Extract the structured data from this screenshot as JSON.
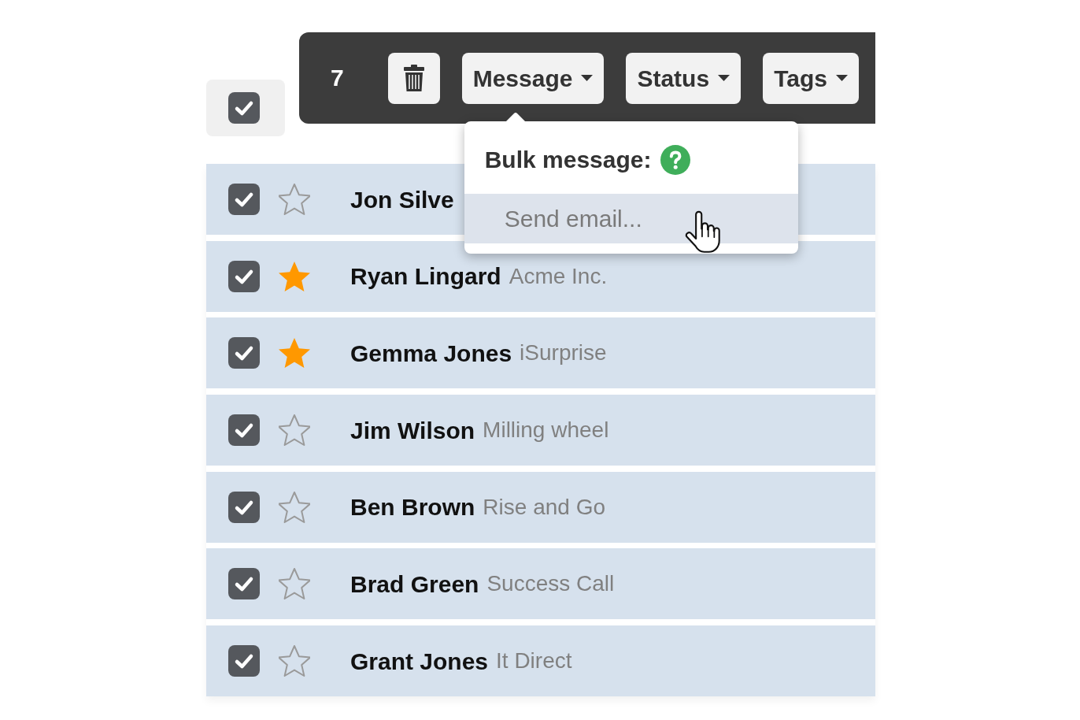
{
  "select_all": {
    "checked": true
  },
  "bulk_toolbar": {
    "count": "7",
    "buttons": [
      {
        "kind": "delete"
      },
      {
        "kind": "dropdown",
        "label": "Message",
        "expanded": true
      },
      {
        "kind": "dropdown",
        "label": "Status",
        "expanded": false
      },
      {
        "kind": "dropdown",
        "label": "Tags",
        "expanded": false
      }
    ]
  },
  "message_menu": {
    "title": "Bulk message:",
    "items": [
      {
        "label": "Send email...",
        "hovered": true
      }
    ]
  },
  "rows": [
    {
      "name": "Jon Silve",
      "checked": true,
      "starred": false
    },
    {
      "name": "Ryan Lingard",
      "company": "Acme Inc.",
      "checked": true,
      "starred": true
    },
    {
      "name": "Gemma Jones",
      "company": "iSurprise",
      "checked": true,
      "starred": true
    },
    {
      "name": "Jim Wilson",
      "company": "Milling wheel",
      "checked": true,
      "starred": false
    },
    {
      "name": "Ben Brown",
      "company": "Rise and Go",
      "checked": true,
      "starred": false
    },
    {
      "name": "Brad Green",
      "company": "Success Call",
      "checked": true,
      "starred": false
    },
    {
      "name": "Grant Jones",
      "company": "It Direct",
      "checked": true,
      "starred": false
    }
  ]
}
